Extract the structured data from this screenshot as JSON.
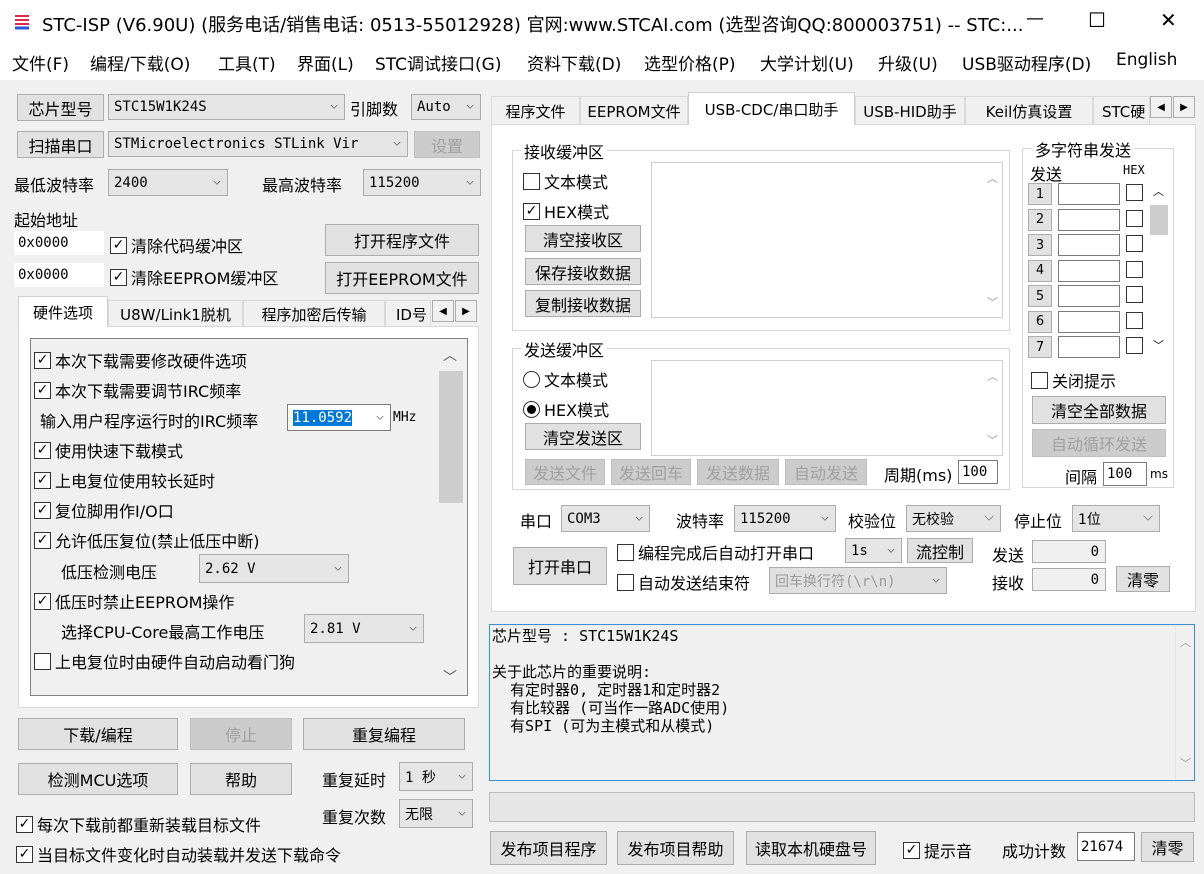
{
  "window": {
    "title": "STC-ISP (V6.90U) (服务电话/销售电话: 0513-55012928) 官网:www.STCAI.com  (选型咨询QQ:800003751) -- STC:...",
    "minimize": "—",
    "maximize": "☐",
    "close": "✕"
  },
  "menu": [
    "文件(F)",
    "编程/下载(O)",
    "工具(T)",
    "界面(L)",
    "STC调试接口(G)",
    "资料下载(D)",
    "选型价格(P)",
    "大学计划(U)",
    "升级(U)",
    "USB驱动程序(D)",
    "English"
  ],
  "left": {
    "chip_btn": "芯片型号",
    "chip": "STC15W1K24S",
    "pins_label": "引脚数",
    "pins": "Auto",
    "scan_btn": "扫描串口",
    "port": "STMicroelectronics STLink Vir",
    "settings_btn": "设置",
    "min_baud_label": "最低波特率",
    "min_baud": "2400",
    "max_baud_label": "最高波特率",
    "max_baud": "115200",
    "start_addr_label": "起始地址",
    "code_addr": "0x0000",
    "clear_code": "清除代码缓冲区",
    "clear_code_checked": true,
    "open_prog": "打开程序文件",
    "eeprom_addr": "0x0000",
    "clear_eeprom": "清除EEPROM缓冲区",
    "clear_eeprom_checked": true,
    "open_eeprom": "打开EEPROM文件",
    "tabs": [
      "硬件选项",
      "U8W/Link1脱机",
      "程序加密后传输",
      "ID号"
    ],
    "options": [
      {
        "label": "本次下载需要修改硬件选项",
        "checked": true
      },
      {
        "label": "本次下载需要调节IRC频率",
        "checked": true
      },
      {
        "label": "使用快速下载模式",
        "checked": true
      },
      {
        "label": "上电复位使用较长延时",
        "checked": true
      },
      {
        "label": "复位脚用作I/O口",
        "checked": true
      },
      {
        "label": "允许低压复位(禁止低压中断)",
        "checked": true
      },
      {
        "label": "低压时禁止EEPROM操作",
        "checked": true
      },
      {
        "label": "上电复位时由硬件自动启动看门狗",
        "checked": false
      }
    ],
    "irc_label": "输入用户程序运行时的IRC频率",
    "irc_value": "11.0592",
    "irc_unit": "MHz",
    "lv_label": "低压检测电压",
    "lv_value": "2.62 V",
    "core_label": "选择CPU-Core最高工作电压",
    "core_value": "2.81 V",
    "download_btn": "下载/编程",
    "stop_btn": "停止",
    "repeat_btn": "重复编程",
    "detect_btn": "检测MCU选项",
    "help_btn": "帮助",
    "delay_label": "重复延时",
    "delay": "1 秒",
    "count_label": "重复次数",
    "count": "无限",
    "reload": "每次下载前都重新装载目标文件",
    "reload_checked": true,
    "auto_send": "当目标文件变化时自动装载并发送下载命令",
    "auto_send_checked": true
  },
  "right": {
    "tabs": [
      "程序文件",
      "EEPROM文件",
      "USB-CDC/串口助手",
      "USB-HID助手",
      "Keil仿真设置",
      "STC硬"
    ],
    "recv": {
      "title": "接收缓冲区",
      "text_mode": "文本模式",
      "text_checked": false,
      "hex_mode": "HEX模式",
      "hex_checked": true,
      "clear": "清空接收区",
      "save": "保存接收数据",
      "copy": "复制接收数据"
    },
    "send": {
      "title": "发送缓冲区",
      "text_mode": "文本模式",
      "hex_mode": "HEX模式",
      "clear": "清空发送区",
      "send_file": "发送文件",
      "send_cr": "发送回车",
      "send_data": "发送数据",
      "auto": "自动发送",
      "period_label": "周期(ms)",
      "period": "100"
    },
    "multi": {
      "title": "多字符串发送",
      "send_label": "发送",
      "hex_label": "HEX",
      "rows": [
        "1",
        "2",
        "3",
        "4",
        "5",
        "6",
        "7"
      ],
      "close_tip": "关闭提示",
      "clear_all": "清空全部数据",
      "auto_loop": "自动循环发送",
      "interval_label": "间隔",
      "interval": "100",
      "ms": "ms"
    },
    "port_label": "串口",
    "port": "COM3",
    "baud_label": "波特率",
    "baud": "115200",
    "parity_label": "校验位",
    "parity": "无校验",
    "stop_label": "停止位",
    "stop": "1位",
    "open_port": "打开串口",
    "auto_open": "编程完成后自动打开串口",
    "auto_open_delay": "1s",
    "flow": "流控制",
    "auto_end": "自动发送结束符",
    "end_char": "回车换行符(\\r\\n)",
    "sent_label": "发送",
    "sent": "0",
    "recv_label": "接收",
    "recv_count": "0",
    "reset": "清零"
  },
  "info": [
    "芯片型号 : STC15W1K24S",
    "",
    "关于此芯片的重要说明:",
    "  有定时器0, 定时器1和定时器2",
    "  有比较器 (可当作一路ADC使用)",
    "  有SPI (可为主模式和从模式)"
  ],
  "bottom": {
    "publish_prog": "发布项目程序",
    "publish_help": "发布项目帮助",
    "read_hdd": "读取本机硬盘号",
    "beep": "提示音",
    "beep_checked": true,
    "success_label": "成功计数",
    "success": "21674",
    "reset": "清零"
  }
}
